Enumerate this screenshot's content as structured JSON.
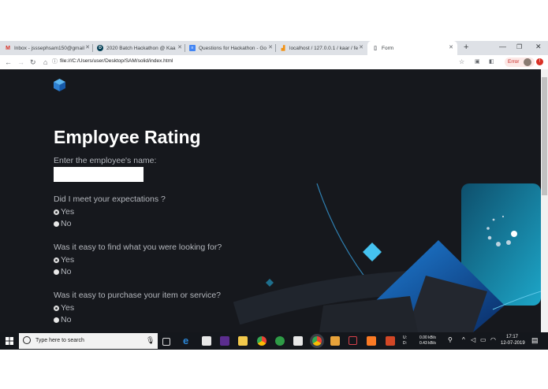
{
  "browser": {
    "tabs": [
      {
        "title": "Inbox - jsssephsam150@gmail",
        "icon": "gmail-icon"
      },
      {
        "title": "2020 Batch Hackathon @ Kaa",
        "icon": "devpost-icon"
      },
      {
        "title": "Questions for Hackathon - Go",
        "icon": "google-docs-icon"
      },
      {
        "title": "localhost / 127.0.0.1 / kaar / fe",
        "icon": "phpmyadmin-icon"
      },
      {
        "title": "Form",
        "icon": "page-icon"
      }
    ],
    "new_tab_symbol": "+",
    "address": "file:///C:/Users/user/Desktop/SAM/solid/index.html",
    "error_badge": "Error"
  },
  "page": {
    "heading": "Employee Rating",
    "name_label": "Enter the employee's name:",
    "name_value": "",
    "questions": [
      {
        "text": "Did I meet your expectations ?",
        "options": [
          "Yes",
          "No"
        ],
        "selected": "Yes"
      },
      {
        "text": "Was it easy to find what you were looking for?",
        "options": [
          "Yes",
          "No"
        ],
        "selected": "Yes"
      },
      {
        "text": "Was it easy to purchase your item or service?",
        "options": [
          "Yes",
          "No"
        ],
        "selected": "Yes"
      }
    ]
  },
  "taskbar": {
    "search_placeholder": "Type here to search",
    "network_up": "0.00 kB/s",
    "network_down": "0.43 kB/s",
    "network_up_label": "U:",
    "network_down_label": "D:",
    "time": "17:17",
    "date": "12-07-2019"
  }
}
